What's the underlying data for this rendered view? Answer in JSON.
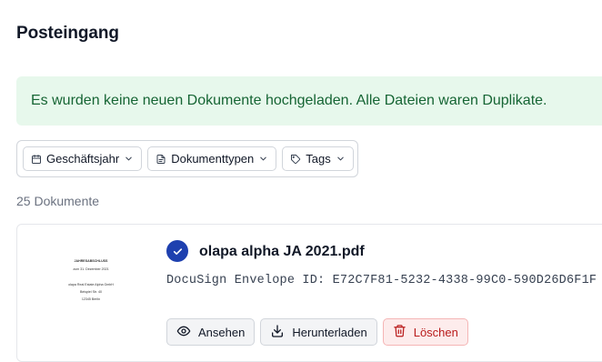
{
  "page": {
    "title": "Posteingang"
  },
  "alert": {
    "message": "Es wurden keine neuen Dokumente hochgeladen. Alle Dateien waren Duplikate."
  },
  "filters": {
    "fiscal_year": "Geschäftsjahr",
    "document_types": "Dokumenttypen",
    "tags": "Tags"
  },
  "documents": {
    "count_label": "25 Dokumente",
    "items": [
      {
        "filename": "olapa alpha JA 2021.pdf",
        "envelope": "DocuSign Envelope ID: E72C7F81-5232-4338-99C0-590D26D6F1F",
        "verified": true,
        "thumbnail_lines": [
          "JAHRESABSCHLUSS",
          "zum 31. Dezember 2021",
          "olapa Real Estate Alpha GmbH",
          "Beispiel Str. 40",
          "12345 Berlin"
        ],
        "actions": {
          "view": "Ansehen",
          "download": "Herunterladen",
          "delete": "Löschen"
        }
      }
    ]
  },
  "colors": {
    "alert_bg": "#e7f8ec",
    "alert_text": "#166534",
    "check_badge": "#1e40af",
    "delete_text": "#b91c1c"
  }
}
